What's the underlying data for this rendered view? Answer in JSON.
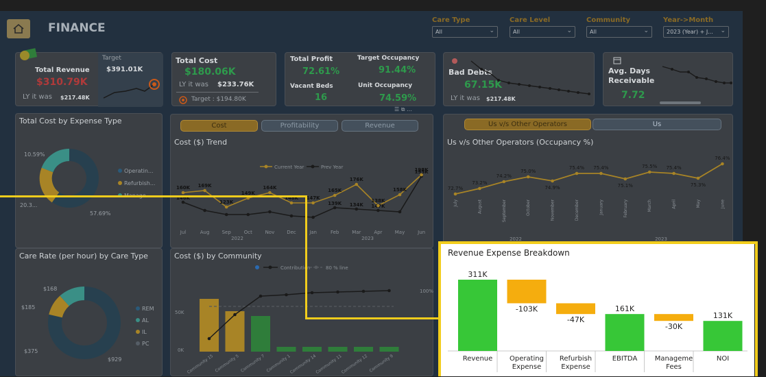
{
  "app": {
    "title": "FINANCE"
  },
  "slicers": [
    {
      "title": "Care Type",
      "value": "All"
    },
    {
      "title": "Care Level",
      "value": "All"
    },
    {
      "title": "Community",
      "value": "All"
    },
    {
      "title": "Year->Month",
      "value": "2023 (Year) + J..."
    }
  ],
  "kpi": {
    "revenue": {
      "title": "Total Revenue",
      "value": "$310.79K",
      "target_label": "Target",
      "target_value": "$391.01K",
      "ly_label": "LY it was",
      "ly_value": "$217.48K"
    },
    "cost": {
      "title": "Total Cost",
      "value": "$180.06K",
      "ly_label": "LY it was",
      "ly_value": "$233.76K",
      "target_text": "Target : $194.80K"
    },
    "profit": {
      "title": "Total Profit",
      "value": "72.61%",
      "vacant_label": "Vacant Beds",
      "vacant_value": "16"
    },
    "occupancy": {
      "target_label": "Target Occupancy",
      "target_value": "91.44%",
      "unit_label": "Unit Occupancy",
      "unit_value": "74.59%"
    },
    "bad_debts": {
      "title": "Bad Debts",
      "value": "67.15K",
      "ly_label": "LY it was",
      "ly_value": "$217.48K"
    },
    "avg_days": {
      "title": "Avg. Days Receivable",
      "value": "7.72"
    }
  },
  "cost_by_expense": {
    "title": "Total Cost by Expense Type",
    "pct_top": "10.59%",
    "pct_left": "20.3...",
    "pct_right": "57.69%",
    "legend": [
      "Operatin...",
      "Refurbish...",
      "Manage..."
    ]
  },
  "cost_trend": {
    "tabs": [
      "Cost",
      "Profitability",
      "Revenue"
    ],
    "title": "Cost ($) Trend",
    "legend": [
      "Current Year",
      "Prev Year"
    ],
    "months": [
      "Jul",
      "Aug",
      "Sep",
      "Oct",
      "Nov",
      "Dec",
      "Jan",
      "Feb",
      "Mar",
      "Apr",
      "May",
      "Jun"
    ],
    "year_labels": [
      "2022",
      "2023"
    ],
    "current_labels": [
      "160K",
      "169K",
      "123K",
      "149K",
      "164K",
      "148K",
      "147K",
      "165K",
      "176K",
      "138K",
      "158K",
      "198K"
    ],
    "prev_labels": [
      "146K",
      "",
      "",
      "",
      "",
      "",
      "",
      "139K",
      "134K",
      "147K",
      "",
      "195K"
    ]
  },
  "operators": {
    "tabs": [
      "Us v/s Other Operators",
      "Us"
    ],
    "title": "Us v/s Other Operators (Occupancy %)",
    "months": [
      "July",
      "August",
      "September",
      "October",
      "November",
      "December",
      "January",
      "February",
      "March",
      "April",
      "May",
      "June"
    ],
    "year_labels": [
      "2022",
      "2023"
    ],
    "labels": [
      "72.7%",
      "73.2%",
      "74.2%",
      "75.0%",
      "74.9%",
      "75.4%",
      "75.4%",
      "75.1%",
      "75.5%",
      "75.4%",
      "75.3%",
      "76.4%"
    ]
  },
  "care_rate": {
    "title": "Care Rate (per hour) by Care Type",
    "labels": [
      "$168",
      "$185",
      "$375",
      "$929"
    ],
    "legend": [
      "REM",
      "AL",
      "IL",
      "PC"
    ]
  },
  "cost_by_community": {
    "title": "Cost ($) by Community",
    "legend": [
      "Contribution",
      "80 % line"
    ],
    "y_left": [
      "50K",
      "0K"
    ],
    "y_right": [
      "100%"
    ],
    "communities": [
      "Community 15",
      "Community 5",
      "Community 7",
      "Community 1",
      "Community 14",
      "Community 11",
      "Community 12",
      "Community 9"
    ]
  },
  "chart_data": {
    "type": "bar",
    "title": "Revenue Expense Breakdown",
    "categories": [
      "Revenue",
      "Operating Expense",
      "Refurbish Expense",
      "EBITDA",
      "Manageme Fees",
      "NOI"
    ],
    "category_lines": [
      [
        "Revenue"
      ],
      [
        "Operating",
        "Expense"
      ],
      [
        "Refurbish",
        "Expense"
      ],
      [
        "EBITDA"
      ],
      [
        "Manageme",
        "Fees"
      ],
      [
        "NOI"
      ]
    ],
    "values": [
      311,
      -103,
      -47,
      161,
      -30,
      131
    ],
    "labels": [
      "311K",
      "-103K",
      "-47K",
      "161K",
      "-30K",
      "131K"
    ],
    "kinds": [
      "total",
      "delta",
      "delta",
      "total",
      "delta",
      "total"
    ],
    "colors": {
      "total": "#37c737",
      "decrease": "#f5ad0e"
    },
    "ylim": [
      0,
      311
    ],
    "subtype": "waterfall"
  }
}
